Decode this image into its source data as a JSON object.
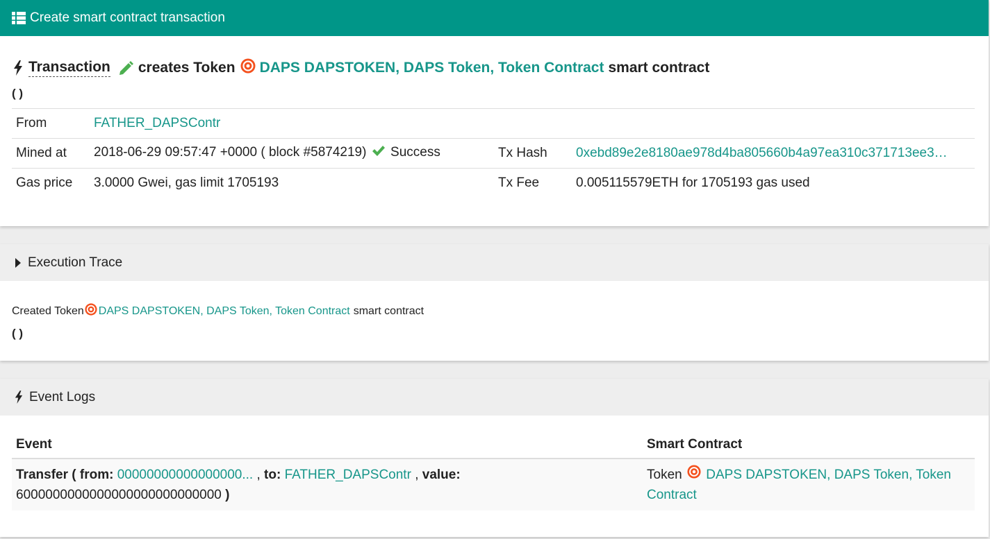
{
  "header": {
    "title": "Create smart contract transaction",
    "bg_color": "#009688"
  },
  "transaction": {
    "label": "Transaction",
    "verb": "creates Token",
    "token_name": "DAPS DAPSTOKEN, DAPS Token, Token Contract",
    "suffix": "smart contract",
    "parens": "( )"
  },
  "details": {
    "from_label": "From",
    "from_value": "FATHER_DAPSContr",
    "mined_label": "Mined at",
    "mined_value": "2018-06-29 09:57:47 +0000 ( block #5874219)",
    "status": "Success",
    "txhash_label": "Tx Hash",
    "txhash_value": "0xebd89e2e8180ae978d4ba805660b4a97ea310c371713ee3…",
    "gas_label": "Gas price",
    "gas_value": "3.0000 Gwei, gas limit 1705193",
    "fee_label": "Tx Fee",
    "fee_value": "0.005115579ETH for 1705193 gas used"
  },
  "trace": {
    "title": "Execution Trace",
    "created_prefix": "Created Token",
    "token_name": "DAPS DAPSTOKEN, DAPS Token, Token Contract",
    "suffix": "smart contract",
    "parens": "( )"
  },
  "events": {
    "title": "Event Logs",
    "col_event": "Event",
    "col_contract": "Smart Contract",
    "row": {
      "name": "Transfer",
      "open": "(",
      "from_key": "from:",
      "from_value": "00000000000000000...",
      "comma1": ",",
      "to_key": "to:",
      "to_value": "FATHER_DAPSContr",
      "comma2": ",",
      "value_key": "value:",
      "value_value": "6000000000000000000000000000",
      "close": ")",
      "contract_prefix": "Token",
      "contract_name": "DAPS DAPSTOKEN, DAPS Token, Token Contract"
    }
  },
  "colors": {
    "accent": "#009688",
    "link": "#17968a",
    "success": "#4caf50",
    "token_logo": "#f4511e"
  }
}
